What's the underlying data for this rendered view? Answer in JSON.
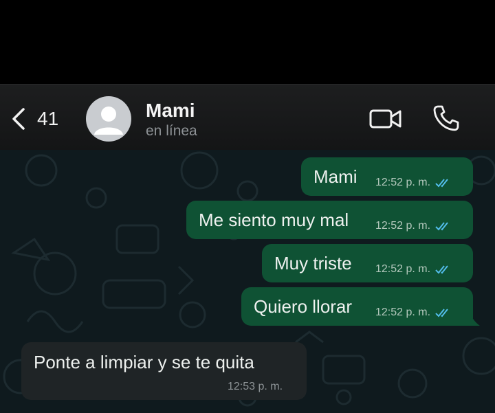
{
  "header": {
    "back_count": "41",
    "contact_name": "Mami",
    "contact_status": "en línea"
  },
  "messages": [
    {
      "direction": "out",
      "text": "Mami",
      "time": "12:52 p. m.",
      "status": "read"
    },
    {
      "direction": "out",
      "text": "Me siento muy mal",
      "time": "12:52 p. m.",
      "status": "read"
    },
    {
      "direction": "out",
      "text": "Muy triste",
      "time": "12:52 p. m.",
      "status": "read"
    },
    {
      "direction": "out",
      "text": "Quiero llorar",
      "time": "12:52 p. m.",
      "status": "read"
    },
    {
      "direction": "in",
      "text": "Ponte a limpiar y se te quita",
      "time": "12:53 p. m."
    }
  ],
  "colors": {
    "outgoing_bubble": "#0f5234",
    "incoming_bubble": "#1f2426",
    "read_ticks": "#53bdeb",
    "chat_background": "#0f1a1e"
  },
  "icons": [
    "back-chevron-icon",
    "avatar-placeholder-icon",
    "video-call-icon",
    "voice-call-icon",
    "double-check-icon"
  ]
}
